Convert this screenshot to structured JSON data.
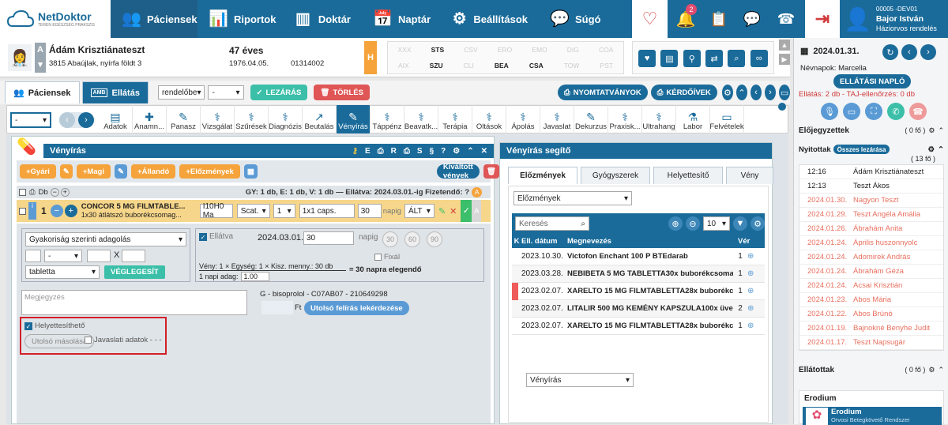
{
  "nav": {
    "logo_name": "NetDoktor",
    "logo_sub": "TEREN EGÉSZSÉG PRAKSZIS",
    "items": [
      {
        "label": "Páciensek",
        "icon": "users-icon"
      },
      {
        "label": "Riportok",
        "icon": "chart-icon"
      },
      {
        "label": "Doktár",
        "icon": "binders-icon"
      },
      {
        "label": "Naptár",
        "icon": "calendar-icon"
      },
      {
        "label": "Beállítások",
        "icon": "gears-icon"
      },
      {
        "label": "Súgó",
        "icon": "help-chat-icon"
      }
    ],
    "notification_count": "2",
    "user_code": "00005 -DEV01",
    "user_name": "Bajor István",
    "user_role": "Háziorvos rendelés"
  },
  "patient": {
    "name": "Ádám Krisztiánateszt",
    "address": "3815 Abaújlak, nyírfa földt 3",
    "age": "47 éves",
    "birth": "1976.04.05.",
    "taj": "01314002",
    "h_badge": "H",
    "a_badge": "A",
    "codes_row1": [
      "XXX",
      "STS",
      "CSV",
      "ERO",
      "EMO",
      "DIG",
      "COA"
    ],
    "codes_row2": [
      "AIX",
      "SZU",
      "CLI",
      "BEA",
      "CSA",
      "TOW",
      "PST"
    ]
  },
  "tabs": {
    "patients": "Páciensek",
    "care": "Ellátás",
    "care_badge": "AMB",
    "select1": "rendelőbe",
    "select2": "-",
    "lock": "LEZÁRÁS",
    "delete": "TÖRLÉS",
    "print": "NYOMTATVÁNYOK",
    "surveys": "KÉRDŐÍVEK"
  },
  "ribbon": {
    "select": "-",
    "items": [
      "Adatok",
      "Anamn...",
      "Panasz",
      "Vizsgálat",
      "Szűrések",
      "Diagnózis",
      "Beutalás",
      "Vényírás",
      "Táppénz",
      "Beavatk...",
      "Terápia",
      "Oltások",
      "Ápolás",
      "Javaslat",
      "Dekurzus",
      "Praxisk...",
      "Ultrahang",
      "Labor",
      "Felvételek"
    ]
  },
  "prescription": {
    "title": "Vényírás",
    "header_letters": [
      "E",
      "R",
      "S",
      "§",
      "?"
    ],
    "btn_gyari": "+Gyári",
    "btn_magi": "+Magi",
    "btn_allando": "+Állandó",
    "btn_elozmenyek": "+Előzmények",
    "btn_kivaltott": "Kiváltott vények",
    "summary_db": "Db",
    "summary": "GY: 1 db,  E: 1 db,  V: 1 db  —  Ellátva: 2024.03.01.-ig  Fizetendő: ?",
    "summary_badge": "A",
    "item_qty": "1",
    "item_name": "CONCOR 5 MG FILMTABLE...",
    "item_pack": "1x30 átlátszó buborékcsomag...",
    "item_code": "I10H0 Ma",
    "item_scat": "Scat.",
    "item_num": "1",
    "item_unit": "1x1 caps.",
    "item_days": "30",
    "item_days_label": "napig",
    "item_alt": "ÁLT",
    "dosage_select": "Gyakoriság szerinti adagolás",
    "dosage_dash": "-",
    "dosage_x": "X",
    "dosage_form": "tabletta",
    "finalize": "VÉGLEGESÍT",
    "ellatva_label": "Ellátva",
    "ellatva_date": "2024.03.01.",
    "ellatva_days": "30",
    "ellatva_napig": "napig",
    "day_opts": [
      "30",
      "60",
      "90"
    ],
    "fixal": "Fixál",
    "formula_top": "Vény: 1 × Egység: 1 × Kisz. menny.: 30 db",
    "formula_bottom": "1 napi adag:",
    "formula_value": "1.00",
    "formula_result": "= 30 napra elegendő",
    "note_placeholder": "Megjegyzés",
    "generic": "G - bisoprolol - C07AB07 - 210649298",
    "ft": "Ft",
    "last_query": "Utolsó felírás lekérdezése",
    "substitutable": "Helyettesíthető",
    "last_copy": "Utolsó másolása",
    "suggestion": "Javaslati adatok - - -"
  },
  "helper": {
    "title": "Vényírás segítő",
    "tabs": [
      "Előzmények",
      "Gyógyszerek",
      "Helyettesítő",
      "Vény"
    ],
    "select": "Előzmények",
    "search_placeholder": "Keresés",
    "page_size": "10",
    "col_k": "K",
    "col_date": "Ell. dátum",
    "col_name": "Megnevezés",
    "col_ver": "Vér",
    "rows": [
      {
        "date": "2023.10.30.",
        "name": "Victofon Enchant 100 P BTEdarab",
        "ver": "1",
        "flag": false
      },
      {
        "date": "2023.03.28.",
        "name": "NEBIBETA 5 MG TABLETTA30x buborékcsomagc",
        "ver": "1",
        "flag": false
      },
      {
        "date": "2023.02.07.",
        "name": "XARELTO 15 MG FILMTABLETTA28x buborékcso",
        "ver": "1",
        "flag": true
      },
      {
        "date": "2023.02.07.",
        "name": "LITALIR 500 MG KEMÉNY KAPSZULA100x üvegb",
        "ver": "2",
        "flag": false
      },
      {
        "date": "2023.02.07.",
        "name": "XARELTO 15 MG FILMTABLETTA28x buborékcso",
        "ver": "1",
        "flag": false
      }
    ],
    "bottom_select": "Vényírás"
  },
  "right": {
    "date": "2024.01.31.",
    "nameday_label": "Névnapok:",
    "nameday": "Marcella",
    "care_log": "ELLÁTÁSI NAPLÓ",
    "care_stats": "Ellátás: 2 db - TAJ-ellenőrzés: 0 db",
    "pre_title": "Előjegyzettek",
    "pre_count": "( 0 fő )",
    "open_title": "Nyitottak",
    "open_badge": "Összes lezárása",
    "open_count": "( 13 fő )",
    "open_list": [
      {
        "t": "12:16",
        "n": "Ádám Krisztiánateszt",
        "red": false
      },
      {
        "t": "12:13",
        "n": "Teszt Ákos",
        "red": false
      },
      {
        "t": "2024.01.30.",
        "n": "Nagyon Teszt",
        "red": true
      },
      {
        "t": "2024.01.29.",
        "n": "Teszt Angéla Amália",
        "red": true
      },
      {
        "t": "2024.01.26.",
        "n": "Ábrahám Anita",
        "red": true
      },
      {
        "t": "2024.01.24.",
        "n": "Április huszonnyolc",
        "red": true
      },
      {
        "t": "2024.01.24.",
        "n": "Adomirek András",
        "red": true
      },
      {
        "t": "2024.01.24.",
        "n": "Ábrahám Géza",
        "red": true
      },
      {
        "t": "2024.01.24.",
        "n": "Acsai Krisztián",
        "red": true
      },
      {
        "t": "2024.01.23.",
        "n": "Abos Mária",
        "red": true
      },
      {
        "t": "2024.01.22.",
        "n": "Abos Brúnó",
        "red": true
      },
      {
        "t": "2024.01.19.",
        "n": "Bajnokné Benyhe Judit",
        "red": true
      },
      {
        "t": "2024.01.17.",
        "n": "Teszt Napsugár",
        "red": true
      }
    ],
    "served_title": "Ellátottak",
    "served_count": "( 0 fő )",
    "erodium_title": "Erodium",
    "erodium_name": "Erodium",
    "erodium_sub": "Orvosi Betegkövető Rendszer"
  }
}
